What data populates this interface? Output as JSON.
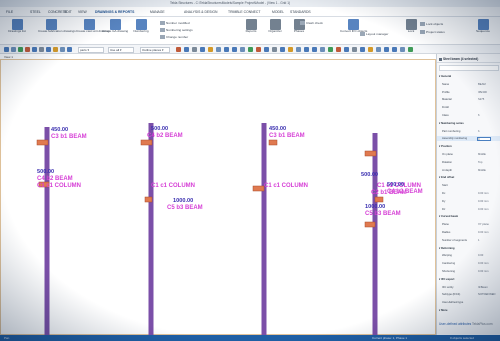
{
  "window": {
    "title": "Tekla Structures - C:\\TeklaStructuresModels\\Sample Project\\Model - (View 1 - Grid 1)"
  },
  "menu": {
    "tabs": [
      {
        "label": "FILE",
        "active": false
      },
      {
        "label": "STEEL",
        "active": false
      },
      {
        "label": "CONCRETE",
        "active": false
      },
      {
        "label": "EDIT",
        "active": false
      },
      {
        "label": "VIEW",
        "active": false
      },
      {
        "label": "DRAWINGS & REPORTS",
        "active": true
      },
      {
        "label": "MANAGE",
        "active": false
      },
      {
        "label": "ANALYSIS & DESIGN",
        "active": false
      },
      {
        "label": "TRIMBLE CONNECT",
        "active": false
      },
      {
        "label": "MODEL",
        "active": false
      },
      {
        "label": "STANDARDS",
        "active": false
      }
    ]
  },
  "ribbon": {
    "buttons": [
      {
        "label": "Drawings list",
        "color": "#3b6fb5"
      },
      {
        "label": "Create fabrication drawings",
        "color": "#3b6fb5"
      },
      {
        "label": "Create cast unit drawing",
        "color": "#3b6fb5"
      },
      {
        "label": "Create GA drawing",
        "color": "#3b6fb5"
      },
      {
        "label": "Numbering",
        "color": "#3b6fb5"
      },
      {
        "label": "Reports",
        "color": "#5a6b7d"
      },
      {
        "label": "Organizer",
        "color": "#5a6b7d"
      },
      {
        "label": "Phases",
        "color": "#5a6b7d"
      },
      {
        "label": "Convert IFC objects",
        "color": "#3b6fb5"
      },
      {
        "label": "Lock",
        "color": "#5a6b7d"
      },
      {
        "label": "Sequence",
        "color": "#3b6fb5"
      }
    ],
    "small": [
      "Number modified",
      "Numbering settings",
      "Change number",
      "Clash check",
      "Layout manager",
      "Lock objects",
      "Project status"
    ]
  },
  "quickbar": {
    "selects": [
      "parts",
      "Use all",
      "Outline planes"
    ]
  },
  "viewport": {
    "tab_label": "View 1",
    "annotations": [
      {
        "tag": "450.00",
        "name": "C3 b1 BEAM"
      },
      {
        "tag": "500.00",
        "name": "C4 b2 BEAM"
      },
      {
        "tag": "500.00",
        "name": "C4 b2 BEAM"
      },
      {
        "tag": "450.00",
        "name": "C3 b1 BEAM"
      },
      {
        "tag": "",
        "name": "C1 c1 COLUMN"
      },
      {
        "tag": "",
        "name": "C1 c1 COLUMN"
      },
      {
        "tag": "",
        "name": "C1 c1 COLUMN"
      },
      {
        "tag": "",
        "name": "C1 c1 COLUMN"
      },
      {
        "tag": "1000.00",
        "name": "C5 b3 BEAM"
      },
      {
        "tag": "500.00",
        "name": "C4 b2 BEAM"
      },
      {
        "tag": "500.00",
        "name": "C2 b1 BEAM"
      },
      {
        "tag": "1000.00",
        "name": "C5 b3 BEAM"
      }
    ]
  },
  "panel": {
    "title": "Steel beam (4 selected)",
    "rows": [
      {
        "k": "General",
        "v": "",
        "sec": true
      },
      {
        "k": "Name",
        "v": "BEAM"
      },
      {
        "k": "Profile",
        "v": "IPE300"
      },
      {
        "k": "Material",
        "v": "S275"
      },
      {
        "k": "Finish",
        "v": ""
      },
      {
        "k": "Class",
        "v": "6"
      },
      {
        "k": "Numbering series",
        "v": "",
        "sec": true
      },
      {
        "k": "Part numbering",
        "v": "b"
      },
      {
        "k": "Assembly numbering",
        "v": "C",
        "hl": true
      },
      {
        "k": "Position",
        "v": "",
        "sec": true
      },
      {
        "k": "On plane",
        "v": "Middle"
      },
      {
        "k": "Rotation",
        "v": "Top"
      },
      {
        "k": "At depth",
        "v": "Middle"
      },
      {
        "k": "End offset",
        "v": "",
        "sec": true
      },
      {
        "k": "Start",
        "v": ""
      },
      {
        "k": "Dx",
        "v": "0.00 mm"
      },
      {
        "k": "Dy",
        "v": "0.00 mm"
      },
      {
        "k": "Dz",
        "v": "0.00 mm"
      },
      {
        "k": "Curved beam",
        "v": "",
        "sec": true
      },
      {
        "k": "Plane",
        "v": "XY plane"
      },
      {
        "k": "Radius",
        "v": "0.00 mm"
      },
      {
        "k": "Number of segments",
        "v": "1"
      },
      {
        "k": "Deforming",
        "v": "",
        "sec": true
      },
      {
        "k": "Warping",
        "v": "0.00"
      },
      {
        "k": "Cambering",
        "v": "0.00 mm"
      },
      {
        "k": "Shortening",
        "v": "0.00 mm"
      },
      {
        "k": "IFC export",
        "v": "",
        "sec": true
      },
      {
        "k": "IFC entity",
        "v": "IfcBeam"
      },
      {
        "k": "Subtype (IFC4)",
        "v": "NOTDEFINED"
      },
      {
        "k": "User-defined type",
        "v": ""
      },
      {
        "k": "More",
        "v": "",
        "sec": true
      }
    ],
    "footer_link": "User-defined attributes",
    "footer_right": "TeklaPlus.com"
  },
  "status": {
    "left": "Pan",
    "mid": "Current phase: 1, Phase 1",
    "right": "0 objects selected"
  }
}
